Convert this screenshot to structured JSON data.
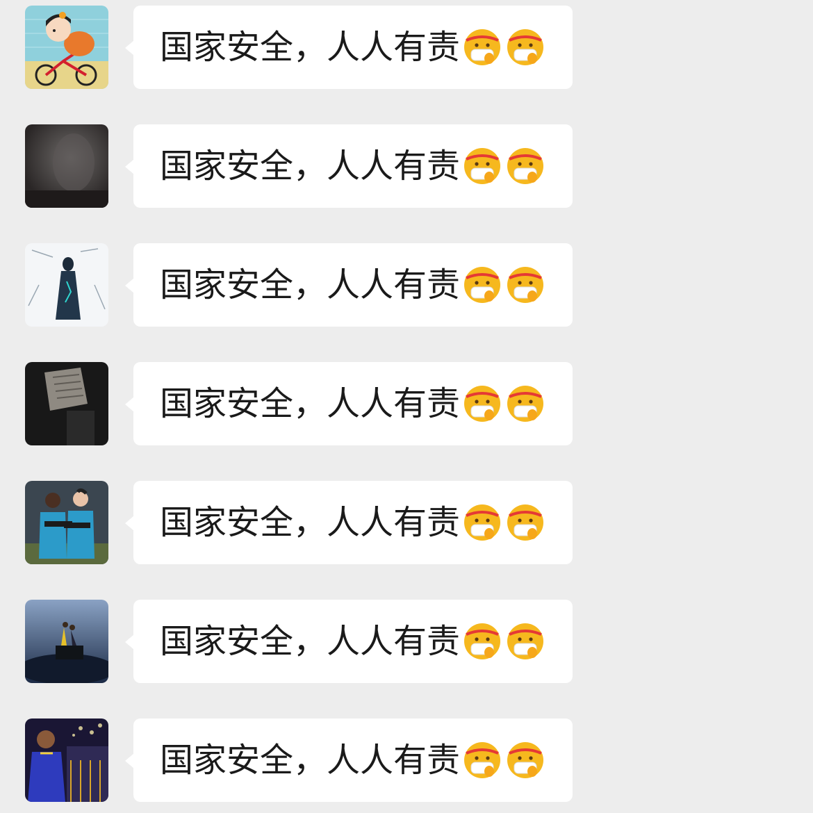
{
  "messages": [
    {
      "text": "国家安全，人人有责",
      "emojis": [
        "mask-face-emoji",
        "mask-face-emoji"
      ],
      "avatar": "cartoon-girl-on-bike-avatar"
    },
    {
      "text": "国家安全，人人有责",
      "emojis": [
        "mask-face-emoji",
        "mask-face-emoji"
      ],
      "avatar": "dark-photo-avatar"
    },
    {
      "text": "国家安全，人人有责",
      "emojis": [
        "mask-face-emoji",
        "mask-face-emoji"
      ],
      "avatar": "sketch-figure-avatar"
    },
    {
      "text": "国家安全，人人有责",
      "emojis": [
        "mask-face-emoji",
        "mask-face-emoji"
      ],
      "avatar": "dark-newspaper-avatar"
    },
    {
      "text": "国家安全，人人有责",
      "emojis": [
        "mask-face-emoji",
        "mask-face-emoji"
      ],
      "avatar": "two-players-avatar"
    },
    {
      "text": "国家安全，人人有责",
      "emojis": [
        "mask-face-emoji",
        "mask-face-emoji"
      ],
      "avatar": "dancers-on-stage-avatar"
    },
    {
      "text": "国家安全，人人有责",
      "emojis": [
        "mask-face-emoji",
        "mask-face-emoji"
      ],
      "avatar": "basketball-player-avatar"
    }
  ],
  "colors": {
    "background": "#ededed",
    "bubble": "#ffffff",
    "text": "#1a1a1a",
    "emoji_face": "#f6b81e"
  }
}
